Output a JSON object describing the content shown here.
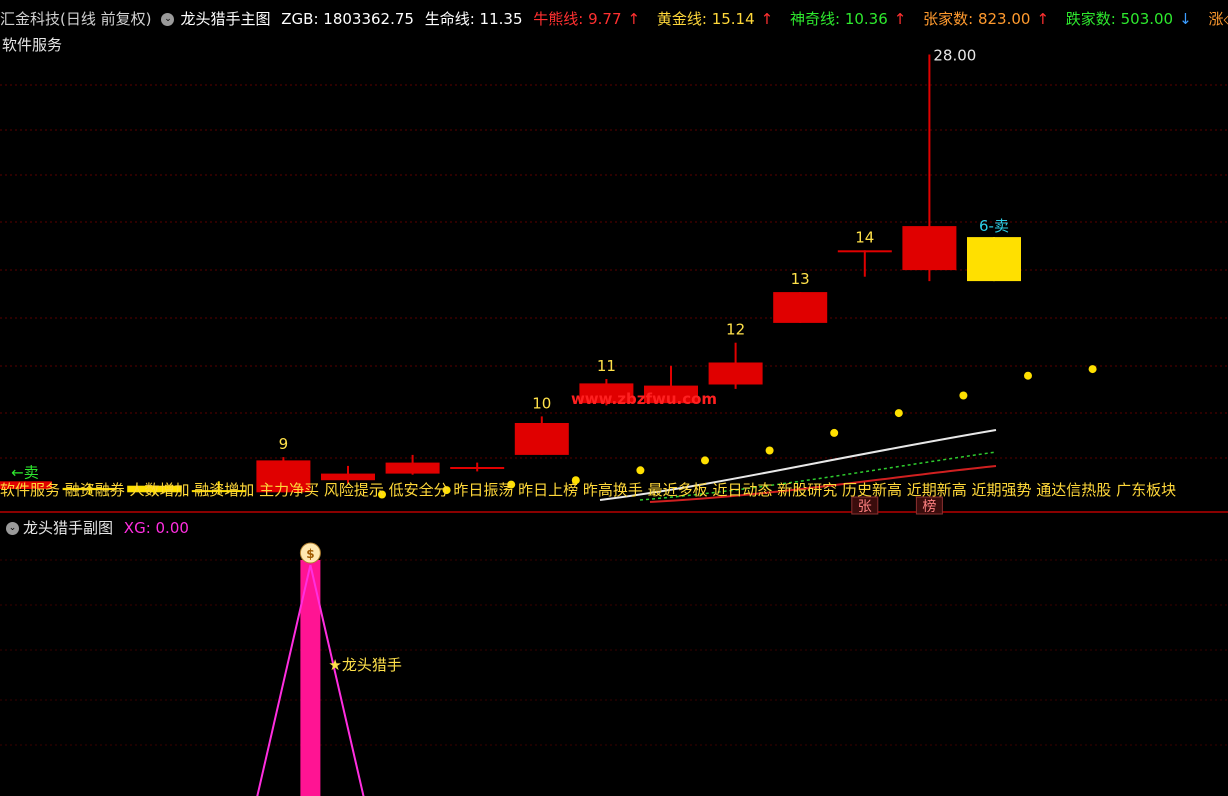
{
  "header": {
    "stock": "汇金科技(日线 前复权)",
    "indicator_name": "龙头猎手主图",
    "zgb": "ZGB: 1803362.75",
    "life_line": "生命线: 11.35",
    "bull_bear": "牛熊线: 9.77",
    "gold_line": "黄金线: 15.14",
    "magic_line": "神奇线: 10.36",
    "up_count": "张家数: 823.00",
    "down_count": "跌家数: 503.00",
    "tail": "涨◇",
    "colors": {
      "stock": "#d0d0d0",
      "indicator_name": "#ffffff",
      "zgb": "#ffffff",
      "life_line": "#ffffff",
      "bull_bear": "#ff3030",
      "gold_line": "#ffd83a",
      "magic_line": "#2ee82e",
      "up_count": "#ff9a2e",
      "down_count": "#2ee82e"
    }
  },
  "sector_label": "软件服务",
  "ticker_text": "软件服务 融资融券 人数增加 融资增加 主力净买 风险提示 低安全分 昨日振荡 昨日上榜 昨高换手 最近多板 近日动态 新股研究 历史新高 近期新高 近期强势 通达信热股 广东板块",
  "watermark": "www.zbzfwu.com",
  "sub_header": {
    "title": "龙头猎手副图",
    "xg": "XG: 0.00"
  },
  "sub_label": "★龙头猎手",
  "chart_data": [
    {
      "type": "candlestick",
      "candles": [
        {
          "open": 8.6,
          "close": 8.25,
          "high": 8.6,
          "low": 8.25,
          "color": "red",
          "label": "←卖"
        },
        {
          "open": 8.2,
          "close": 8.3,
          "high": 8.5,
          "low": 8.0,
          "color": "yellow"
        },
        {
          "open": 8.4,
          "close": 8.1,
          "high": 8.4,
          "low": 8.0,
          "color": "yellow"
        },
        {
          "open": 8.2,
          "close": 8.15,
          "high": 8.6,
          "low": 8.0,
          "color": "yellow"
        },
        {
          "open": 8.1,
          "close": 9.55,
          "high": 9.7,
          "low": 8.1,
          "color": "red",
          "label": "9"
        },
        {
          "open": 8.65,
          "close": 8.95,
          "high": 9.3,
          "low": 8.5,
          "color": "red"
        },
        {
          "open": 8.95,
          "close": 9.45,
          "high": 9.8,
          "low": 8.9,
          "color": "red"
        },
        {
          "open": 9.25,
          "close": 9.25,
          "high": 9.45,
          "low": 9.05,
          "color": "red"
        },
        {
          "open": 9.8,
          "close": 11.25,
          "high": 11.55,
          "low": 9.8,
          "color": "red",
          "label": "10"
        },
        {
          "open": 12.15,
          "close": 13.05,
          "high": 13.25,
          "low": 12.05,
          "color": "red",
          "label": "11"
        },
        {
          "open": 12.15,
          "close": 12.95,
          "high": 13.85,
          "low": 12.15,
          "color": "red"
        },
        {
          "open": 13.0,
          "close": 14.0,
          "high": 14.9,
          "low": 12.8,
          "color": "red",
          "label": "12"
        },
        {
          "open": 15.8,
          "close": 17.2,
          "high": 17.2,
          "low": 15.8,
          "color": "red",
          "label": "13"
        },
        {
          "open": 19.1,
          "close": 19.1,
          "high": 19.1,
          "low": 17.9,
          "color": "red",
          "label": "14"
        },
        {
          "open": 18.2,
          "close": 20.2,
          "high": 28.0,
          "low": 17.7,
          "color": "red",
          "label": "28.00"
        },
        {
          "open": 19.7,
          "close": 17.7,
          "high": 19.7,
          "low": 17.7,
          "color": "yellow",
          "label": "6-卖"
        }
      ],
      "dots": [
        null,
        null,
        null,
        null,
        null,
        8.0,
        8.2,
        8.45,
        8.65,
        9.1,
        9.55,
        10.0,
        10.8,
        11.7,
        12.5,
        13.4,
        13.7
      ],
      "badges": [
        {
          "candle": 13,
          "text": "张"
        },
        {
          "candle": 14,
          "text": "榜"
        }
      ]
    },
    {
      "type": "bar",
      "bar_index": 4,
      "value": 1,
      "icon_label": "$"
    }
  ]
}
